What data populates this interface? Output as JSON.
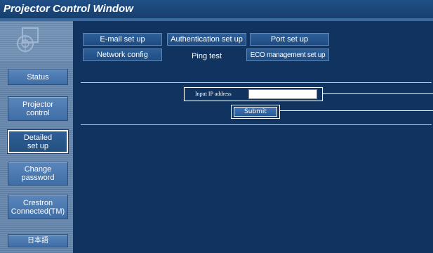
{
  "window": {
    "title": "Projector Control Window"
  },
  "sidebar": {
    "items": [
      {
        "label": "Status",
        "active": false
      },
      {
        "label": "Projector control",
        "active": false
      },
      {
        "label": "Detailed set up",
        "active": true
      },
      {
        "label": "Change password",
        "active": false
      },
      {
        "label": "Crestron Connected(TM)",
        "active": false
      },
      {
        "label": "日本語",
        "active": false
      }
    ]
  },
  "tabs": {
    "row1": [
      "E-mail set up",
      "Authentication set up",
      "Port set up"
    ],
    "row2": [
      "Network config",
      "Ping test",
      "ECO management set up"
    ],
    "active": "Ping test"
  },
  "form": {
    "ip_label": "Input IP address",
    "ip_value": "",
    "submit_label": "Submit"
  },
  "colors": {
    "background": "#11335f",
    "sidebar": "#6d8cb0",
    "button": "#3f6ea6",
    "accent": "#ffffff"
  }
}
